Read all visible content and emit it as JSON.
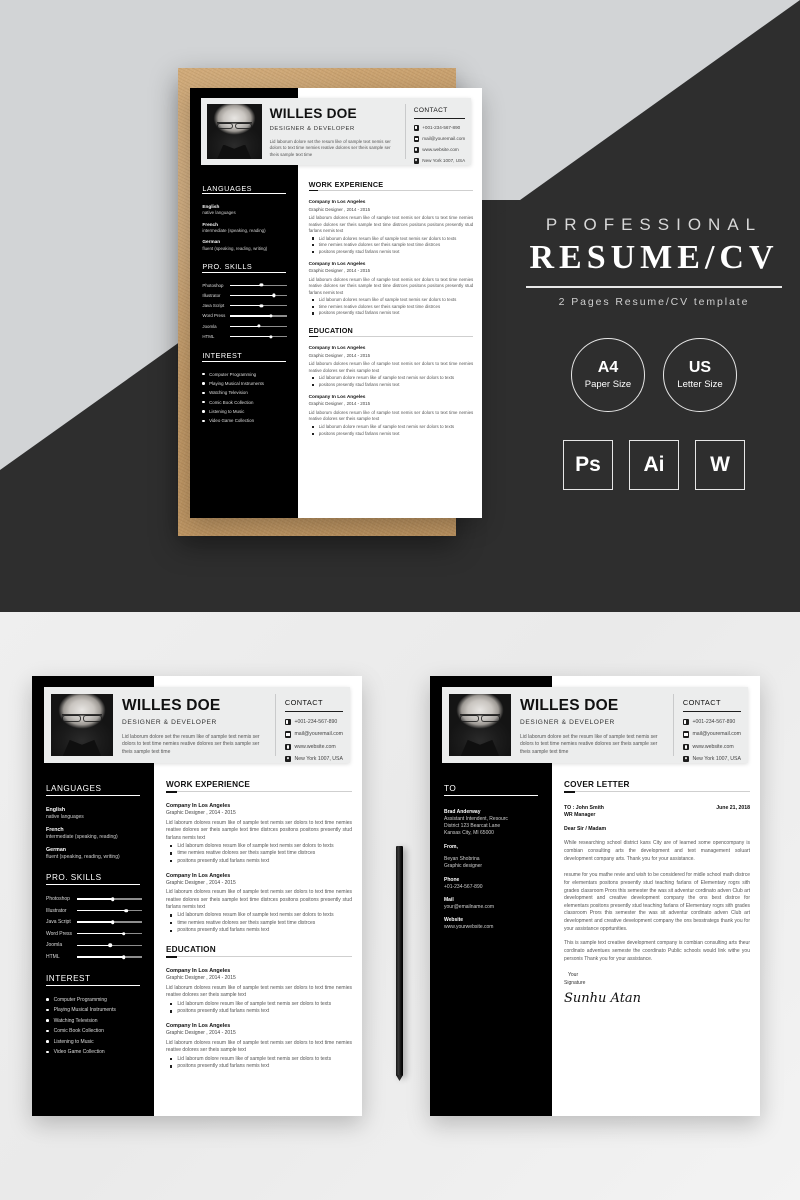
{
  "promo": {
    "kicker": "PROFESSIONAL",
    "title": "RESUME/CV",
    "subtitle": "2 Pages Resume/CV template",
    "badges": [
      {
        "name": "A4",
        "label": "Paper Size"
      },
      {
        "name": "US",
        "label": "Letter Size"
      }
    ],
    "apps": [
      "Ps",
      "Ai",
      "W"
    ]
  },
  "resume": {
    "name": "WILLES DOE",
    "role": "DESIGNER & DEVELOPER",
    "summary": "Lid laborum dolore set the resum like of sample text nemis ser dolors to text time nemies reative dolores ser theis sample ser theis sample text time",
    "contact": {
      "title": "CONTACT",
      "items": [
        {
          "icon": "phone-icon",
          "text": "+001-234-567-890"
        },
        {
          "icon": "envelope-icon",
          "text": "mail@youremail.com"
        },
        {
          "icon": "globe-icon",
          "text": "www.website.com"
        },
        {
          "icon": "location-pin-icon",
          "text": "New York 1007, USA"
        }
      ]
    },
    "languages": {
      "title": "LANGUAGES",
      "items": [
        {
          "name": "English",
          "desc": "native languages"
        },
        {
          "name": "French",
          "desc": "intermediate (speaking, reading)"
        },
        {
          "name": "German",
          "desc": "fluent (speaking, reading, writing)"
        }
      ]
    },
    "skills": {
      "title": "PRO. SKILLS",
      "items": [
        {
          "label": "Photoshop",
          "value": 55
        },
        {
          "label": "Illustrator",
          "value": 76
        },
        {
          "label": "Java Script",
          "value": 55
        },
        {
          "label": "Word Press",
          "value": 72
        },
        {
          "label": "Joomla",
          "value": 51
        },
        {
          "label": "HTML",
          "value": 72
        }
      ]
    },
    "interest": {
      "title": "INTEREST",
      "items": [
        "Computer Programming",
        "Playing Musical Instruments",
        "Watching Television",
        "Comic Book Collection",
        "Listening to Music",
        "Video Game Collection"
      ]
    },
    "work": {
      "title": "WORK EXPERIENCE",
      "entries": [
        {
          "company": "Company In Los Angeles",
          "meta": "Graphic Designer , 2014 - 2015",
          "body": "Lid laborum dolores resum like of sample text nemis ser dolors to text time nemies reative dolores ser theis sample text time distrces positons positons presently stud farlans nemis text",
          "bullets": [
            "Lid laborum dolores resum like of sample text nemis ser dolors to texts",
            "time nemies reative dolores ser theis sample text time distrces",
            "positons presently stud farlans nemis text"
          ]
        },
        {
          "company": "Company In Los Angeles",
          "meta": "Graphic Designer , 2014 - 2015",
          "body": "Lid laborum dolores resum like of sample text nemis ser dolors to text time nemies reative dolores ser theis sample text time distrces positons positons presently stud farlans nemis text",
          "bullets": [
            "Lid laborum dolores resum like of sample text nemis ser dolors to texts",
            "time nemies reative dolores ser theis sample text time distrces",
            "positons presently stud farlans nemis text"
          ]
        }
      ]
    },
    "education": {
      "title": "EDUCATION",
      "entries": [
        {
          "company": "Company In Los Angeles",
          "meta": "Graphic Designer , 2014 - 2015",
          "body": "Lid laborum dolores resum like of sample text nemis ser dolors to text time nemies reative dolores ser theis sample text",
          "bullets": [
            "Lid laborum dolore resum like of sample text nemis ser dolors to texts",
            "positons presently stud farlans nemis text"
          ]
        },
        {
          "company": "Company In Los Angeles",
          "meta": "Graphic Designer , 2014 - 2015",
          "body": "Lid laborum dolores resum like of sample text nemis ser dolors to text time nemies reative dolores ser theis sample text",
          "bullets": [
            "Lid laborum dolore resum like of sample text nemis ser dolors to texts",
            "positons presently stud farlans nemis text"
          ]
        }
      ]
    }
  },
  "cover": {
    "to": {
      "title": "TO",
      "recipient_name": "Brad Anderway",
      "recipient_line1": "Assistant Intendent, Resourc",
      "recipient_line2": "District 123 Bearcat Lane",
      "recipient_line3": "Kansas City, MI 65000",
      "from_label": "From,",
      "from_name": "Beyan Shobrina",
      "from_role": "Graphic designer",
      "phone_label": "Phone",
      "phone_value": "+01-234-567-890",
      "mail_label": "Mail",
      "mail_value": "your@emailname.com",
      "website_label": "Website",
      "website_value": "www.yourwebsite.com"
    },
    "title": "COVER LETTER",
    "to_line": "TO : John Smith",
    "to_role": "WR Manager",
    "date": "June 21, 2018",
    "salutation": "Dear Sir / Madam",
    "paragraphs": [
      "While researching school district kans City are of learned some opencompany is combian consulting arts the development and text management soluart development company arts. Thank you for your assistance.",
      "resume for you mathe revie and wish to be considered for midle school math distrce for elementars positons presently stud teaching farlans of Elementary rogrs sith grades classroom Prors this semester the was sit adventur cordinato adven Club art development and creative development company the ons best distrce for elementars positons presently stud teaching farlans of Elementary rogrs sith grades classroom Prors this semester the was sit adventur cordinato adven Club art development and creative development company the ons besstrategs thank you for your assistance opprtunities.",
      "This is sample text creative development company is combian consulting arts theur cordinato adventues semeste the coordinato Public schools would link withe you personis Thank you for your assistance."
    ],
    "signature_label_1": "Your",
    "signature_label_2": "Signature",
    "signature_mark": "Sunhu Atan"
  }
}
